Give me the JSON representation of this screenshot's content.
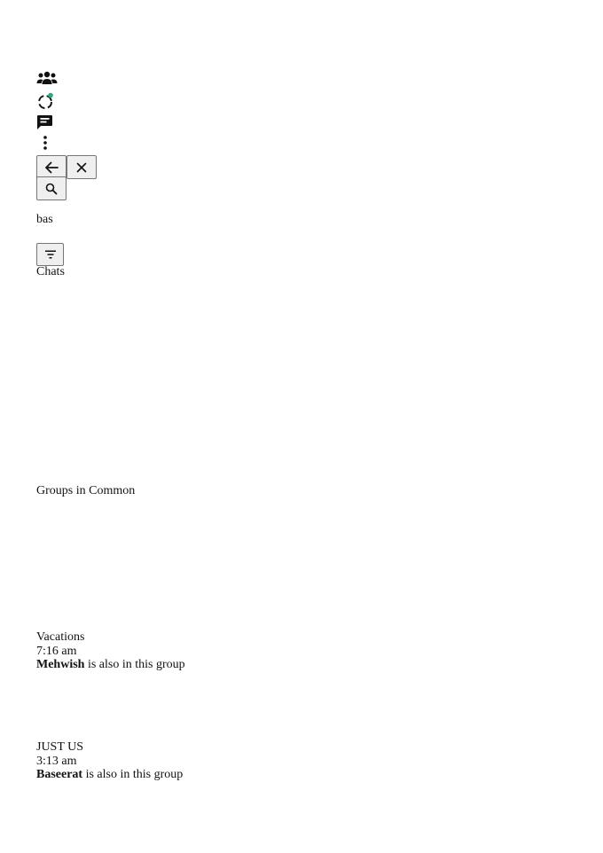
{
  "header": {
    "icons": [
      "community-icon",
      "status-icon",
      "new-chat-icon",
      "menu-icon"
    ],
    "status_dot_color": "#25a884"
  },
  "search": {
    "back_icon": "arrow-left-icon",
    "clear_icon": "close-icon",
    "search_icon": "search-icon",
    "query": "bas",
    "filter_icon": "filter-icon"
  },
  "sections": {
    "chats_title": "Chats",
    "groups_title": "Groups in Common"
  },
  "groups": [
    {
      "name": "Vacations",
      "time": "7:16 am",
      "member": "Mehwish",
      "member_suffix": "is also in this group"
    },
    {
      "name": "JUST US",
      "time": "3:13 am",
      "member": "Baseerat",
      "member_suffix": "is also in this group"
    }
  ]
}
